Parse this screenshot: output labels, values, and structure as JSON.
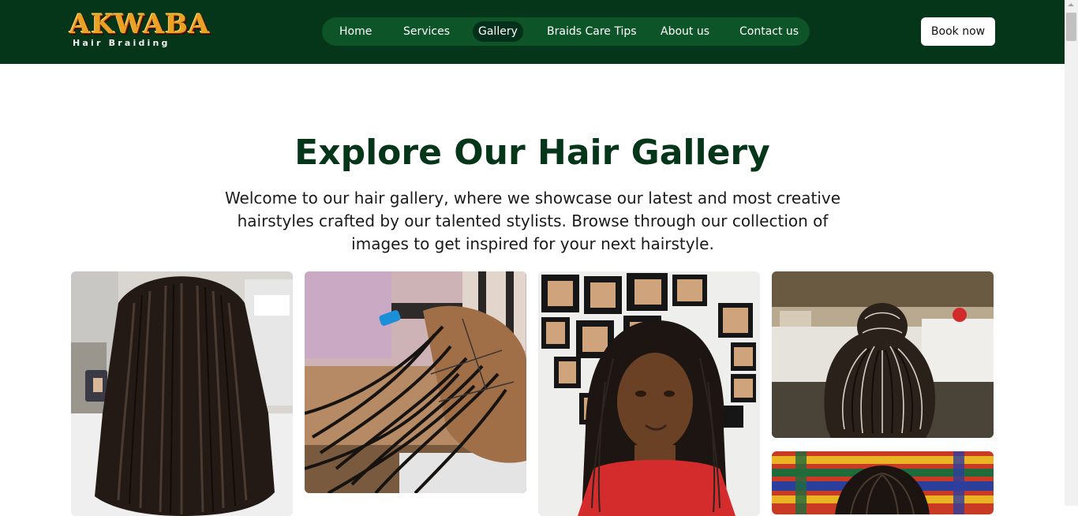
{
  "brand": {
    "name": "AKWABA",
    "tagline": "Hair Braiding"
  },
  "nav": {
    "items": [
      {
        "label": "Home",
        "active": false
      },
      {
        "label": "Services",
        "active": false
      },
      {
        "label": "Gallery",
        "active": true
      },
      {
        "label": "Braids Care Tips",
        "active": false
      },
      {
        "label": "About us",
        "active": false
      },
      {
        "label": "Contact us",
        "active": false
      }
    ],
    "cta": "Book now"
  },
  "gallery": {
    "title": "Explore Our Hair Gallery",
    "intro": "Welcome to our hair gallery, where we showcase our latest and most creative hairstyles crafted by our talented stylists. Browse through our collection of images to get inspired for your next hairstyle.",
    "images": [
      {
        "subject": "twist braids back view"
      },
      {
        "subject": "knotless braids in progress"
      },
      {
        "subject": "woman with long micro braids"
      },
      {
        "subject": "feed-in braids updo"
      },
      {
        "subject": "braids with kente background"
      }
    ]
  },
  "colors": {
    "header_bg": "#05361a",
    "nav_bg": "#0d5428",
    "nav_active": "#03301a",
    "title": "#05361a",
    "logo_gold": "#e9a223"
  }
}
